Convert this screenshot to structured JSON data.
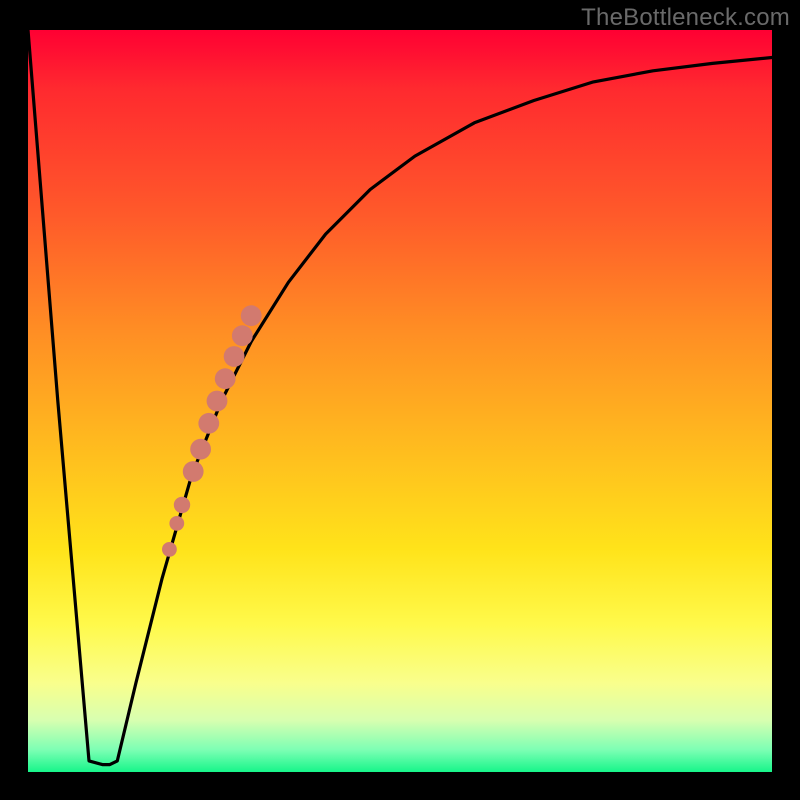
{
  "attribution": "TheBottleneck.com",
  "colors": {
    "frame": "#000000",
    "curve": "#000000",
    "marker": "#d27a6f",
    "attribution": "#6a6a6a",
    "gradient_stops": [
      "#ff0033",
      "#ff2a2f",
      "#ff5a2a",
      "#ff8c24",
      "#ffb81f",
      "#ffe31a",
      "#fff94a",
      "#f9ff8c",
      "#d8ffb0",
      "#7dffb4",
      "#17f58a"
    ]
  },
  "chart_data": {
    "type": "line",
    "title": "",
    "xlabel": "",
    "ylabel": "",
    "x": [
      0.0,
      0.04,
      0.082,
      0.1,
      0.11,
      0.12,
      0.145,
      0.18,
      0.22,
      0.26,
      0.3,
      0.35,
      0.4,
      0.46,
      0.52,
      0.6,
      0.68,
      0.76,
      0.84,
      0.92,
      1.0
    ],
    "values": [
      1.0,
      0.5,
      0.015,
      0.01,
      0.01,
      0.015,
      0.12,
      0.26,
      0.4,
      0.5,
      0.58,
      0.66,
      0.725,
      0.785,
      0.83,
      0.875,
      0.905,
      0.93,
      0.945,
      0.955,
      0.963
    ],
    "xlim": [
      0,
      1
    ],
    "ylim": [
      0,
      1
    ],
    "markers": [
      {
        "x": 0.19,
        "y": 0.3,
        "r": 0.01
      },
      {
        "x": 0.2,
        "y": 0.335,
        "r": 0.01
      },
      {
        "x": 0.207,
        "y": 0.36,
        "r": 0.011
      },
      {
        "x": 0.222,
        "y": 0.405,
        "r": 0.014
      },
      {
        "x": 0.232,
        "y": 0.435,
        "r": 0.014
      },
      {
        "x": 0.243,
        "y": 0.47,
        "r": 0.014
      },
      {
        "x": 0.254,
        "y": 0.5,
        "r": 0.014
      },
      {
        "x": 0.265,
        "y": 0.53,
        "r": 0.014
      },
      {
        "x": 0.277,
        "y": 0.56,
        "r": 0.014
      },
      {
        "x": 0.288,
        "y": 0.588,
        "r": 0.014
      },
      {
        "x": 0.3,
        "y": 0.615,
        "r": 0.014
      }
    ],
    "annotations": []
  }
}
